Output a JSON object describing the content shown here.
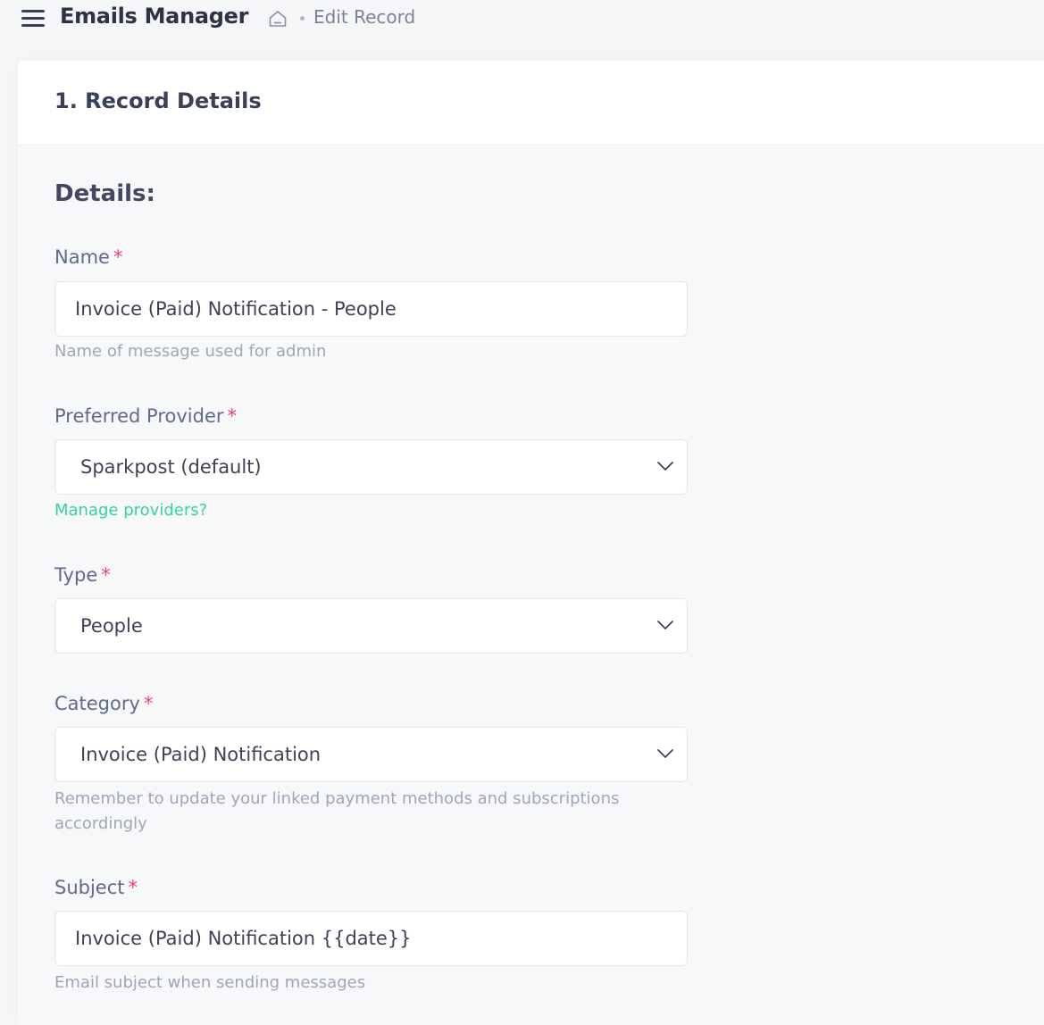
{
  "header": {
    "app_title": "Emails Manager",
    "breadcrumb_current": "Edit Record"
  },
  "card": {
    "step_title": "1. Record Details",
    "section_title": "Details:"
  },
  "fields": {
    "name": {
      "label": "Name",
      "required": "*",
      "value": "Invoice (Paid) Notification - People",
      "help": "Name of message used for admin"
    },
    "provider": {
      "label": "Preferred Provider",
      "required": "*",
      "value": "Sparkpost (default)",
      "link": "Manage providers?"
    },
    "type": {
      "label": "Type",
      "required": "*",
      "value": "People"
    },
    "category": {
      "label": "Category",
      "required": "*",
      "value": "Invoice (Paid) Notification",
      "help": "Remember to update your linked payment methods and subscriptions accordingly"
    },
    "subject": {
      "label": "Subject",
      "required": "*",
      "value": "Invoice (Paid) Notification {{date}}",
      "help": "Email subject when sending messages"
    }
  },
  "icons": {
    "menu": "hamburger-menu-icon",
    "home": "home-icon",
    "chevron": "chevron-down-icon"
  },
  "colors": {
    "required": "#f1416c",
    "link": "#34d399"
  }
}
